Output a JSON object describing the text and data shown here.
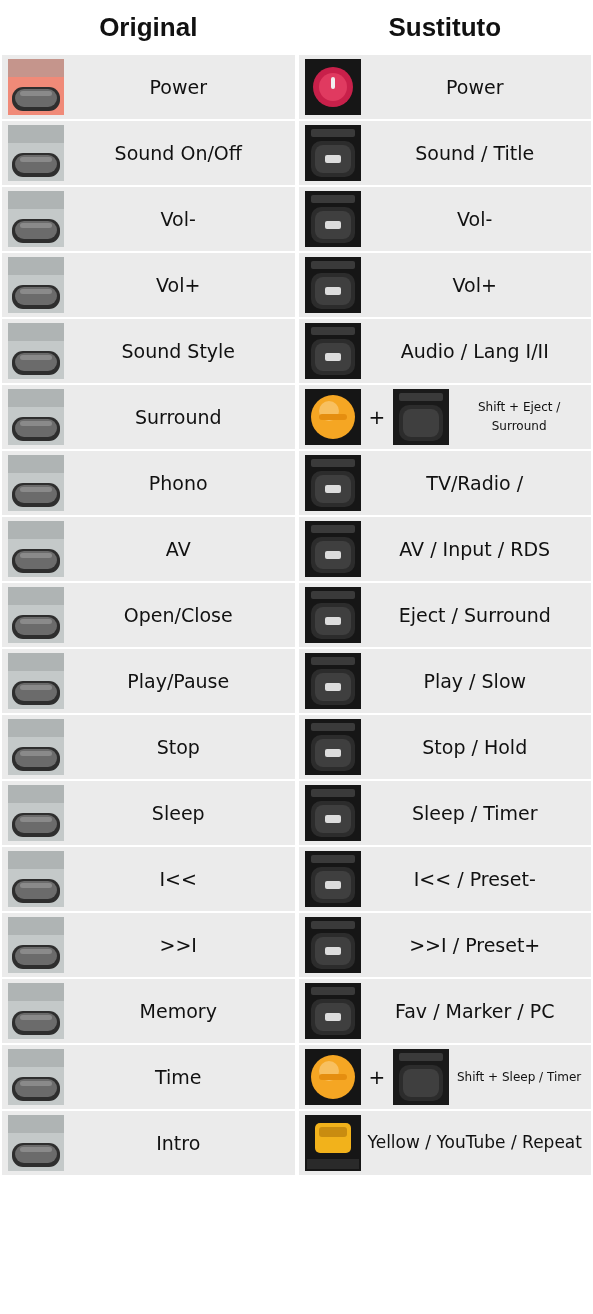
{
  "headers": [
    "Original",
    "Sustituto"
  ],
  "rows": [
    {
      "original": {
        "label": "Power"
      },
      "substitute": {
        "kind": "single",
        "label": "Power"
      }
    },
    {
      "original": {
        "label": "Sound On/Off"
      },
      "substitute": {
        "kind": "single",
        "label": "Sound / Title"
      }
    },
    {
      "original": {
        "label": "Vol-"
      },
      "substitute": {
        "kind": "single",
        "label": "Vol-"
      }
    },
    {
      "original": {
        "label": "Vol+"
      },
      "substitute": {
        "kind": "single",
        "label": "Vol+"
      }
    },
    {
      "original": {
        "label": "Sound Style"
      },
      "substitute": {
        "kind": "single",
        "label": "Audio / Lang I/II"
      }
    },
    {
      "original": {
        "label": "Surround"
      },
      "substitute": {
        "kind": "combo",
        "plus": "+",
        "label": "Shift + Eject / Surround"
      }
    },
    {
      "original": {
        "label": "Phono"
      },
      "substitute": {
        "kind": "single",
        "label": "TV/Radio /"
      }
    },
    {
      "original": {
        "label": "AV"
      },
      "substitute": {
        "kind": "single",
        "label": "AV / Input / RDS"
      }
    },
    {
      "original": {
        "label": "Open/Close"
      },
      "substitute": {
        "kind": "single",
        "label": "Eject / Surround"
      }
    },
    {
      "original": {
        "label": "Play/Pause"
      },
      "substitute": {
        "kind": "single",
        "label": "Play / Slow"
      }
    },
    {
      "original": {
        "label": "Stop"
      },
      "substitute": {
        "kind": "single",
        "label": "Stop / Hold"
      }
    },
    {
      "original": {
        "label": "Sleep"
      },
      "substitute": {
        "kind": "single",
        "label": "Sleep / Timer"
      }
    },
    {
      "original": {
        "label": "I<<"
      },
      "substitute": {
        "kind": "single",
        "label": "I<< / Preset-"
      }
    },
    {
      "original": {
        "label": ">>I"
      },
      "substitute": {
        "kind": "single",
        "label": ">>I / Preset+"
      }
    },
    {
      "original": {
        "label": "Memory"
      },
      "substitute": {
        "kind": "single",
        "label": "Fav / Marker / PC"
      }
    },
    {
      "original": {
        "label": "Time"
      },
      "substitute": {
        "kind": "combo",
        "plus": "+",
        "label": "Shift + Sleep / Timer"
      }
    },
    {
      "original": {
        "label": "Intro"
      },
      "substitute": {
        "kind": "wrapped",
        "label": "Yellow / YouTube / Repeat"
      }
    }
  ]
}
